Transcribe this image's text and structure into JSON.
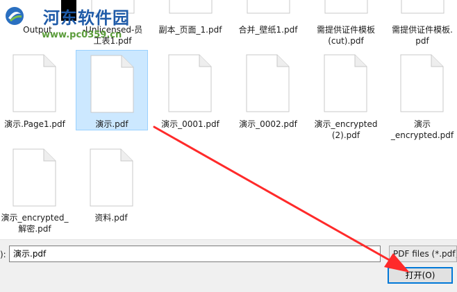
{
  "watermark": {
    "site_name": "河东软件园",
    "site_url": "www.pc0359.cn"
  },
  "files": [
    {
      "label_lines": [
        "Output"
      ]
    },
    {
      "label_lines": [
        "-Unlicensed-员",
        "工表1.pdf"
      ]
    },
    {
      "label_lines": [
        "副本_页面_1.pdf"
      ]
    },
    {
      "label_lines": [
        "合并_壁纸1.pdf"
      ]
    },
    {
      "label_lines": [
        "需提供证件模板",
        "(cut).pdf"
      ]
    },
    {
      "label_lines": [
        "需提供证件模板.",
        "pdf"
      ]
    },
    {
      "label_lines": [
        "演示.Page1.pdf"
      ]
    },
    {
      "label_lines": [
        "演示.pdf"
      ],
      "selected": true
    },
    {
      "label_lines": [
        "演示_0001.pdf"
      ]
    },
    {
      "label_lines": [
        "演示_0002.pdf"
      ]
    },
    {
      "label_lines": [
        "演示_encrypted",
        "(2).pdf"
      ]
    },
    {
      "label_lines": [
        "演示",
        "_encrypted.pdf"
      ]
    },
    {
      "label_lines": [
        "演示_encrypted_",
        "解密.pdf"
      ]
    },
    {
      "label_lines": [
        "资料.pdf"
      ]
    }
  ],
  "footer": {
    "filename_label_fragment": "):",
    "filename_value": "演示.pdf",
    "filetype_value": "PDF files (*.pdf)",
    "open_button_label": "打开(O)"
  },
  "colors": {
    "selection_bg": "#cce8ff",
    "selection_border": "#99d1ff",
    "annotation_red": "#ff2a2a",
    "accent_blue": "#0078d7"
  }
}
